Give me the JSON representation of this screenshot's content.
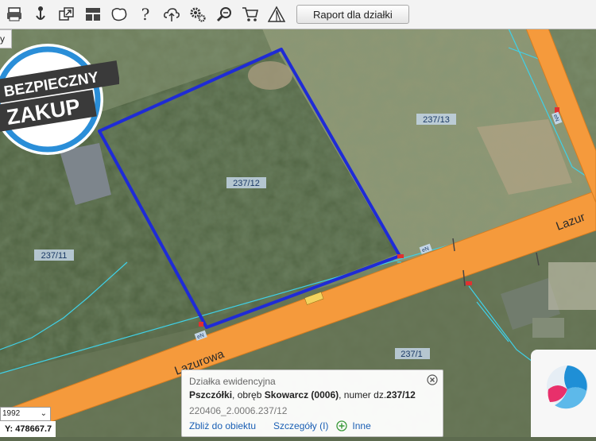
{
  "toolbar": {
    "icons": [
      "print-icon",
      "pin-icon",
      "layers-icon",
      "layout-icon",
      "map-shape-icon",
      "help-icon",
      "cloud-upload-icon",
      "settings-icon",
      "zoom-search-icon",
      "cart-icon",
      "warning-icon"
    ],
    "report_label": "Raport dla działki"
  },
  "left_tab": {
    "label": "y"
  },
  "badge": {
    "line1": "BEZPIECZNY",
    "line2": "ZAKUP"
  },
  "map": {
    "parcel_labels": [
      "237/13",
      "237/12",
      "237/11",
      "237/1"
    ],
    "street_labels": [
      "Lazurowa",
      "Lazur"
    ],
    "small_labels": [
      "eN",
      "eN",
      "eN"
    ],
    "colors": {
      "parcel_outline": "#1f2bd6",
      "road": "#f59a3c",
      "boundary": "#3fd1e8"
    }
  },
  "coords": {
    "crs": "1992",
    "y_label": "Y: 478667.7"
  },
  "popup": {
    "title": "Działka ewidencyjna",
    "locality": "Pszczółki",
    "obreb_prefix": ", obręb ",
    "obreb": "Skowarcz (0006)",
    "numer_prefix": ", numer dz.",
    "numer": "237/12",
    "teryt": "220406_2.0006.237/12",
    "link_zoom": "Zbliż do obiektu",
    "link_details": "Szczegóły (I)",
    "link_other": "Inne"
  }
}
